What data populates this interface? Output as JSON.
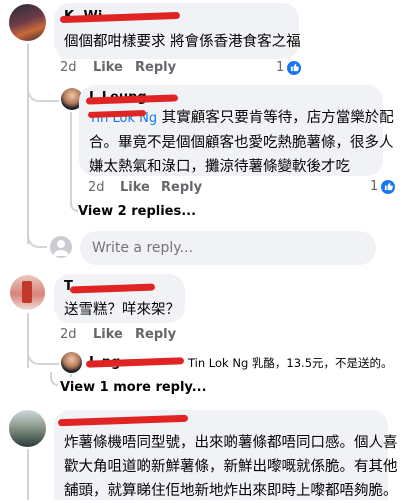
{
  "comment1": {
    "author": "K. Wi",
    "text": "個個都咁樣要求 將會係香港食客之福",
    "time": "2d",
    "like": "Like",
    "reply": "Reply",
    "reaction_count": "1"
  },
  "reply1": {
    "author": "L      Leung",
    "tag": "Tin Lok Ng",
    "text_lines": [
      "其實顧客只要肯等待，店方當樂於配",
      "合。畢竟不是個個顧客也愛吃熱脆薯條，很多人",
      "嫌太熱氣和淥口，攤涼待薯條變軟後才吃"
    ],
    "time": "2d",
    "like": "Like",
    "reply": "Reply",
    "reaction_count": "1",
    "view_replies": "View 2 replies..."
  },
  "write_reply": {
    "placeholder": "Write a reply..."
  },
  "comment2": {
    "author": "T",
    "text": "送雪糕？咩來架？",
    "time": "2d",
    "like": "Like",
    "reply": "Reply"
  },
  "reply2": {
    "author": "L        ng",
    "preview": "Tin Lok Ng 乳酪，13.5元，不是送的。",
    "view_more": "View 1 more reply..."
  },
  "comment3": {
    "author": "",
    "text_lines": [
      "炸薯條機唔同型號，出來啲薯條都唔同口感。個人喜",
      "歡大角咀道啲新鮮薯條，新鮮出嚟嘅就係脆。有其他",
      "舖頭，就算睇住佢地新地炸出來即時上嚟都唔夠脆。"
    ]
  },
  "colors": {
    "accent": "#1877f2",
    "bubble": "#f0f2f5",
    "meta": "#65676b",
    "redaction": "#e02424"
  }
}
